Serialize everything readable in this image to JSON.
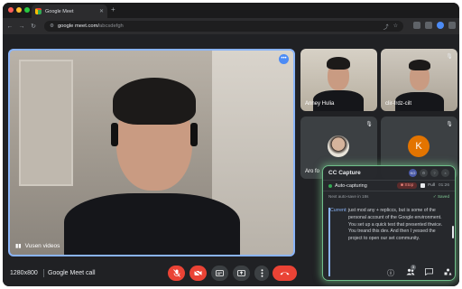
{
  "browser": {
    "tab_title": "Google Meet",
    "url": "google meet.com/",
    "url_dim": "abcsdefgh",
    "colors": {
      "close": "#ff5f57",
      "min": "#febc2e",
      "max": "#28c840"
    }
  },
  "meet": {
    "main_participant": "Vusen videos",
    "tiles": [
      {
        "name": "Anney Hulia",
        "muted": false
      },
      {
        "name": "clir-frdz-cilt",
        "muted": true
      },
      {
        "name": "Aro fo",
        "muted": true
      },
      {
        "name": "",
        "avatar_letter": "K",
        "muted": true
      }
    ],
    "bottom_bar": {
      "resolution": "1280x800",
      "call_name": "Google Meet call",
      "people_count": "3"
    }
  },
  "cc_panel": {
    "title": "CC Capture",
    "buttons": [
      "KO",
      "⚙",
      "?",
      "×"
    ],
    "auto_label": "Auto-capturing",
    "stop_label": "■ Stop",
    "format_label": "Full",
    "timer": "01:26",
    "save_text": "Next auto-save in 18s",
    "saved_text": "✓ Saved",
    "current_label": "Current:",
    "transcript": "just mod any + repliccs, but is some of the personal account of the Google environment. You set up a quick test that presented thwice. You treand this dev. And then I yessed the project to open our set community."
  },
  "icons": {
    "mic_off": "mic-off-icon",
    "cam_off": "camera-off-icon",
    "captions": "captions-icon",
    "present": "present-icon",
    "more": "more-vert-icon",
    "hangup": "hangup-icon",
    "info": "info-icon",
    "people": "people-icon",
    "chat": "chat-icon",
    "activities": "activities-icon"
  },
  "colors": {
    "accent": "#8ab4f8",
    "danger": "#ea4335",
    "panel_glow": "#6fbf8a"
  }
}
